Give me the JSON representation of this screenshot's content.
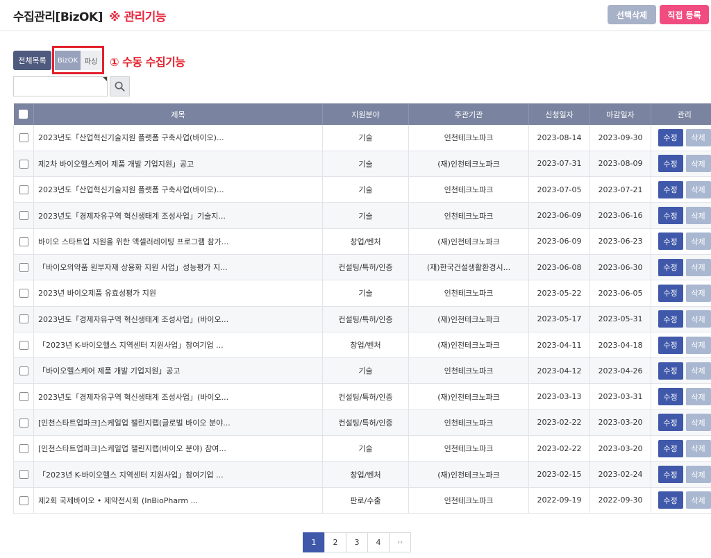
{
  "header": {
    "title": "수집관리[BizOK]",
    "admin_note": "※ 관리기능",
    "select_delete_label": "선택삭제",
    "direct_register_label": "직접 등록"
  },
  "tabs": {
    "all_label": "전체목록",
    "bizok_label": "BizOK",
    "parse_label": "파싱",
    "manual_note": "① 수동 수집기능"
  },
  "search": {
    "value": "",
    "icon": "search-icon"
  },
  "table": {
    "columns": [
      "제목",
      "지원분야",
      "주관기관",
      "신청일자",
      "마감일자",
      "관리"
    ],
    "edit_label": "수정",
    "delete_label": "삭제",
    "rows": [
      {
        "title": "2023년도「산업혁신기술지원 플랫폼 구축사업(바이오)...",
        "field": "기술",
        "org": "인천테크노파크",
        "apply": "2023-08-14",
        "deadline": "2023-09-30"
      },
      {
        "title": "제2차 바이오헬스케어 제품 개발 기업지원」공고",
        "field": "기술",
        "org": "(재)인천테크노파크",
        "apply": "2023-07-31",
        "deadline": "2023-08-09"
      },
      {
        "title": "2023년도「산업혁신기술지원 플랫폼 구축사업(바이오)...",
        "field": "기술",
        "org": "인천테크노파크",
        "apply": "2023-07-05",
        "deadline": "2023-07-21"
      },
      {
        "title": "2023년도「경제자유구역 혁신생태계 조성사업」기술지...",
        "field": "기술",
        "org": "인천테크노파크",
        "apply": "2023-06-09",
        "deadline": "2023-06-16"
      },
      {
        "title": "바이오 스타트업 지원을 위한 액셀러레이팅 프로그램 참가...",
        "field": "창업/벤처",
        "org": "(재)인천테크노파크",
        "apply": "2023-06-09",
        "deadline": "2023-06-23"
      },
      {
        "title": "「바이오의약품 원부자재 상용화 지원 사업」성능평가 지...",
        "field": "컨설팅/특허/인증",
        "org": "(재)한국건설생활환경시...",
        "apply": "2023-06-08",
        "deadline": "2023-06-30"
      },
      {
        "title": "2023년 바이오제품 유효성평가 지원",
        "field": "기술",
        "org": "인천테크노파크",
        "apply": "2023-05-22",
        "deadline": "2023-06-05"
      },
      {
        "title": "2023년도「경제자유구역 혁신생태계 조성사업」(바이오...",
        "field": "컨설팅/특허/인증",
        "org": "(재)인천테크노파크",
        "apply": "2023-05-17",
        "deadline": "2023-05-31"
      },
      {
        "title": "「2023년 K-바이오헬스 지역센터 지원사업」참여기업 ...",
        "field": "창업/벤처",
        "org": "(재)인천테크노파크",
        "apply": "2023-04-11",
        "deadline": "2023-04-18"
      },
      {
        "title": "「바이오헬스케어 제품 개발 기업지원」공고",
        "field": "기술",
        "org": "인천테크노파크",
        "apply": "2023-04-12",
        "deadline": "2023-04-26"
      },
      {
        "title": "2023년도「경제자유구역 혁신생태계 조성사업」(바이오...",
        "field": "컨설팅/특허/인증",
        "org": "(재)인천테크노파크",
        "apply": "2023-03-13",
        "deadline": "2023-03-31"
      },
      {
        "title": "[인천스타트업파크]스케일업 챌린지랩(글로벌 바이오 분야...",
        "field": "컨설팅/특허/인증",
        "org": "인천테크노파크",
        "apply": "2023-02-22",
        "deadline": "2023-03-20"
      },
      {
        "title": "[인천스타트업파크]스케일업 챌린지랩(바이오 분야) 참여...",
        "field": "기술",
        "org": "인천테크노파크",
        "apply": "2023-02-22",
        "deadline": "2023-03-20"
      },
      {
        "title": "「2023년 K-바이오헬스 지역센터 지원사업」참여기업 ...",
        "field": "창업/벤처",
        "org": "(재)인천테크노파크",
        "apply": "2023-02-15",
        "deadline": "2023-02-24"
      },
      {
        "title": "제2회 국제바이오 • 제약전시회 (InBioPharm ...",
        "field": "판로/수출",
        "org": "인천테크노파크",
        "apply": "2022-09-19",
        "deadline": "2022-09-30"
      }
    ]
  },
  "pagination": {
    "pages": [
      "1",
      "2",
      "3",
      "4"
    ],
    "current": "1",
    "next_label": "››"
  },
  "colors": {
    "accent": "#3f58a9",
    "header_bg": "#7a84a0",
    "alert_red": "#e2202b",
    "pink": "#f04c7f"
  }
}
